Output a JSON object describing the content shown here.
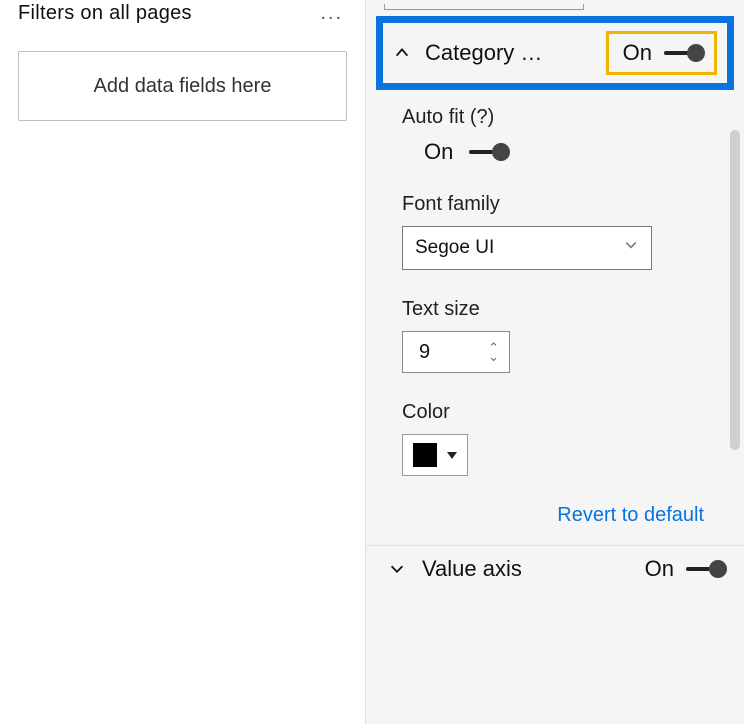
{
  "left": {
    "filters_header": "Filters on all pages",
    "more_dots": "...",
    "dropzone_text": "Add data fields here"
  },
  "format": {
    "category": {
      "label": "Category …",
      "toggle": "On"
    },
    "autofit": {
      "label": "Auto fit (?)",
      "toggle": "On"
    },
    "font_family": {
      "label": "Font family",
      "value": "Segoe UI"
    },
    "text_size": {
      "label": "Text size",
      "value": "9"
    },
    "color": {
      "label": "Color",
      "value": "#000000"
    },
    "revert": "Revert to default",
    "value_axis": {
      "label": "Value axis",
      "toggle": "On"
    }
  }
}
